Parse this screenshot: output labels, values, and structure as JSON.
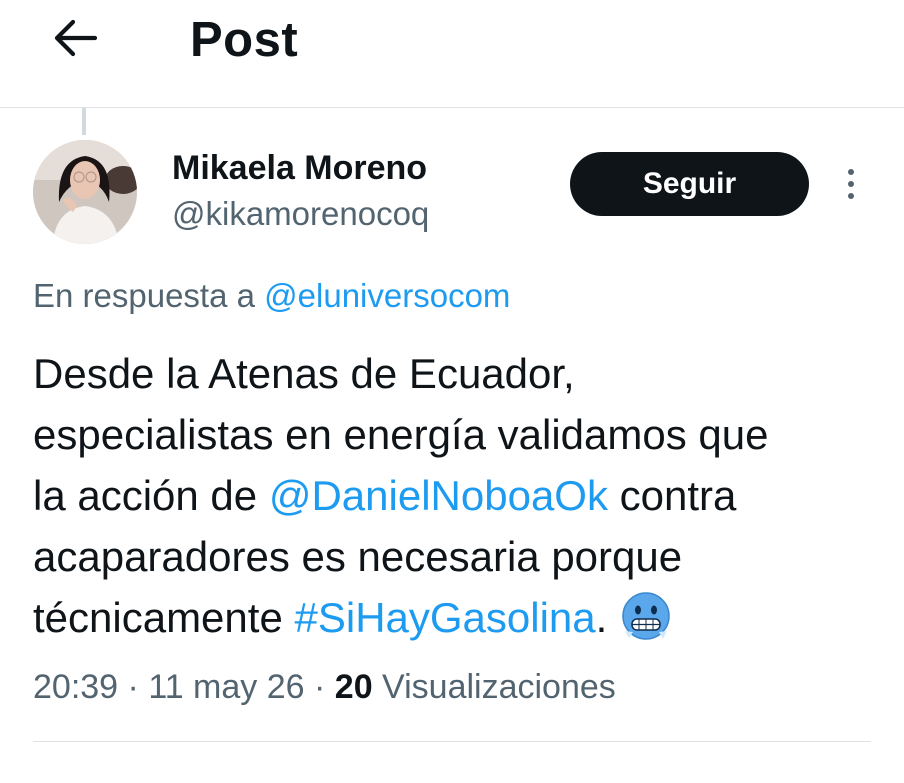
{
  "header": {
    "back_icon": "arrow-left-icon",
    "title": "Post"
  },
  "author": {
    "display_name": "Mikaela Moreno",
    "handle": "@kikamorenocoq",
    "avatar_icon": "profile-photo"
  },
  "actions": {
    "follow_label": "Seguir",
    "more_icon": "more-vertical-icon"
  },
  "reply_context": {
    "prefix": "En respuesta a ",
    "mention": "@eluniversocom"
  },
  "tweet": {
    "line1": "Desde la Atenas de Ecuador,",
    "line2": "especialistas en energía validamos que",
    "line3_before": "la acción de ",
    "line3_mention": "@DanielNoboaOk",
    "line3_after": " contra",
    "line4": "acaparadores es necesaria porque",
    "line5_before": "técnicamente ",
    "line5_hashtag": "#SiHayGasolina",
    "line5_after": ".",
    "emoji_icon": "cold-face-emoji-icon"
  },
  "meta": {
    "time": "20:39",
    "sep1": " · ",
    "date": "11 may 26",
    "sep2": " · ",
    "views_count": "20",
    "views_label": " Visualizaciones"
  },
  "colors": {
    "link": "#1d9bf0",
    "text": "#0f1419",
    "secondary": "#536471",
    "button_bg": "#0f1419"
  }
}
